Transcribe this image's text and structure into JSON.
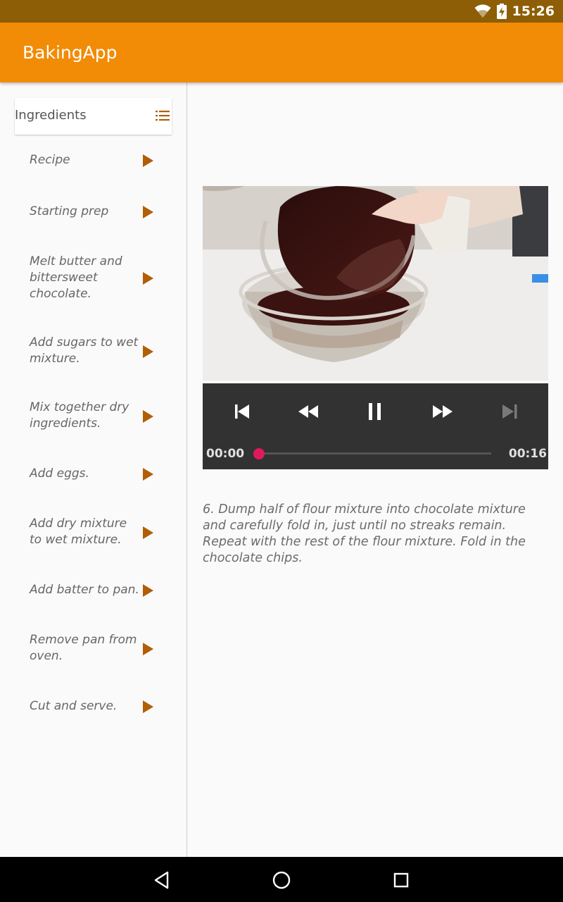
{
  "status_bar": {
    "time": "15:26"
  },
  "app_bar": {
    "title": "BakingApp"
  },
  "sidebar": {
    "ingredients_label": "Ingredients",
    "steps": [
      {
        "label": "Recipe"
      },
      {
        "label": "Starting prep"
      },
      {
        "label": "Melt butter and bittersweet chocolate."
      },
      {
        "label": "Add sugars to wet mixture."
      },
      {
        "label": "Mix together dry ingredients."
      },
      {
        "label": "Add eggs."
      },
      {
        "label": "Add dry mixture to wet mixture."
      },
      {
        "label": "Add batter to pan."
      },
      {
        "label": "Remove pan from oven."
      },
      {
        "label": "Cut and serve."
      }
    ]
  },
  "player": {
    "position": "00:00",
    "duration": "00:16",
    "progress_fraction": 0.0
  },
  "step_description": "6. Dump half of flour mixture into chocolate mixture and carefully fold in, just until no streaks remain. Repeat with the rest of the flour mixture. Fold in the chocolate chips.",
  "colors": {
    "status_bar": "#8d5e05",
    "app_bar": "#f28b05",
    "accent_icon": "#b25e05",
    "progress_accent": "#e91e63",
    "player_bg": "#323232"
  },
  "icons": {
    "wifi": "wifi-icon",
    "battery": "battery-charging-icon",
    "ingredients": "list-icon",
    "step": "play-arrow-icon",
    "previous": "skip-previous-icon",
    "rewind": "rewind-icon",
    "pause": "pause-icon",
    "fast_forward": "fast-forward-icon",
    "next": "skip-next-icon",
    "back": "back-icon",
    "home": "home-icon",
    "recents": "recents-icon"
  }
}
